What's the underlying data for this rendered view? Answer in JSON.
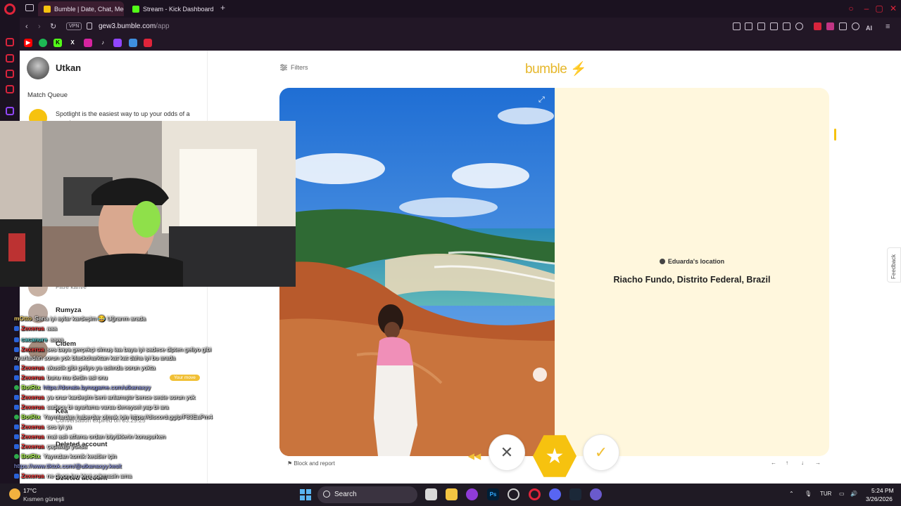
{
  "browser": {
    "tabs": [
      {
        "label": "Bumble | Date, Chat, Meet",
        "active": true
      },
      {
        "label": "Stream - Kick Dashboard",
        "active": false
      }
    ],
    "new_tab": "+",
    "vpn_label": "VPN",
    "url_domain": "gew3.bumble.com",
    "url_path": "/app",
    "ai_label": "AI",
    "bookmarks": [
      "youtube-icon",
      "spotify-icon",
      "kick-icon",
      "x-icon",
      "instagram-icon",
      "tiktok-icon",
      "twitch-icon",
      "bookmark-icon",
      "bookmark-icon"
    ]
  },
  "sidebar": {
    "user_name": "Utkan",
    "match_queue_title": "Match Queue",
    "spotlight_text": "Spotlight is the easiest way to up your odds of a match",
    "conversations": [
      {
        "name": "Rumyza",
        "preview": "Filtre kahve"
      },
      {
        "name": "Cidem",
        "preview": ""
      },
      {
        "name": "Kea",
        "preview": "Conversation expired on 03.29.25"
      },
      {
        "name": "Deleted account",
        "preview": ""
      },
      {
        "name": "Deleted account",
        "preview": ""
      }
    ],
    "your_move_badge": "Your move"
  },
  "main": {
    "filters_label": "Filters",
    "logo": "bumble",
    "location_label": "Eduarda's location",
    "location_value": "Riacho Fundo, Distrito Federal, Brazil",
    "block_report": "Block and report",
    "feedback": "Feedback",
    "keyboard_hints": [
      "←",
      "↑",
      "↓",
      "→"
    ]
  },
  "chat": [
    {
      "user": "mOtto",
      "color": "#f3d36b",
      "badge": "",
      "msg": "Sana iyi aylar kardeşim 😂 Uğrarım arada",
      "link": false
    },
    {
      "user": "Zexerua",
      "color": "#ff3d3d",
      "badge": "sub",
      "msg": "aaa",
      "link": false
    },
    {
      "user": "cacanure",
      "color": "#5dd6d6",
      "badge": "sub",
      "msg": "aaaa",
      "link": false
    },
    {
      "user": "Zexerua",
      "color": "#ff3d3d",
      "badge": "sub",
      "msg": "ses baya gerçekçi olmuş iaa baya iyi sadece dipten geliyo gibi",
      "link": false
    },
    {
      "user": "",
      "color": "#ffffff",
      "badge": "",
      "msg": "ayarlardan sorun yok blackcharktan kat kat daha iyi bu arada",
      "link": false
    },
    {
      "user": "Zexerua",
      "color": "#ff3d3d",
      "badge": "sub",
      "msg": "akustik gibi geliyo ya aslında sorun yokta",
      "link": false
    },
    {
      "user": "Zexerua",
      "color": "#ff3d3d",
      "badge": "sub",
      "msg": "bunu mu dedin asl onu",
      "link": false
    },
    {
      "user": "BotRix",
      "color": "#b7ff5a",
      "badge": "bot",
      "msg": "https://donate.bynogame.com/utkanaxyy",
      "link": true
    },
    {
      "user": "Zexerua",
      "color": "#ff3d3d",
      "badge": "sub",
      "msg": "ya onur kardeşim beni anlamıştır bence seste sorun yok",
      "link": false
    },
    {
      "user": "Zexerua",
      "color": "#ff3d3d",
      "badge": "sub",
      "msg": "sadece bi ayarlama varsa deneysel yap bi ara",
      "link": false
    },
    {
      "user": "BotRix",
      "color": "#b7ff5a",
      "badge": "bot",
      "msg": "Yayınlardan haberdar olmak için https://discord.gg/p/F83EaPm4",
      "link": false
    },
    {
      "user": "Zexerua",
      "color": "#ff3d3d",
      "badge": "sub",
      "msg": "ses iyi ya",
      "link": false
    },
    {
      "user": "Zexerua",
      "color": "#ff3d3d",
      "badge": "sub",
      "msg": "mal asli atfama ordan büyüklerin konuşurken",
      "link": false
    },
    {
      "user": "Zexerua",
      "color": "#ff3d3d",
      "badge": "sub",
      "msg": "çapalağı yoksa",
      "link": false
    },
    {
      "user": "BotRix",
      "color": "#b7ff5a",
      "badge": "bot",
      "msg": "Yayından komik kesitler için",
      "link": false
    },
    {
      "user": "",
      "color": "#ffffff",
      "badge": "",
      "msg": "https://www.tiktok.com/@utkanaxyy.kesit",
      "link": true
    },
    {
      "user": "Zexerua",
      "color": "#ff3d3d",
      "badge": "sub",
      "msg": "ne diyon lan kimi sokmasin ama",
      "link": false
    }
  ],
  "taskbar": {
    "weather_temp": "17°C",
    "weather_desc": "Kısmen güneşli",
    "search_label": "Search",
    "lang": "TUR",
    "time": "5:24 PM",
    "date": "3/26/2026"
  }
}
